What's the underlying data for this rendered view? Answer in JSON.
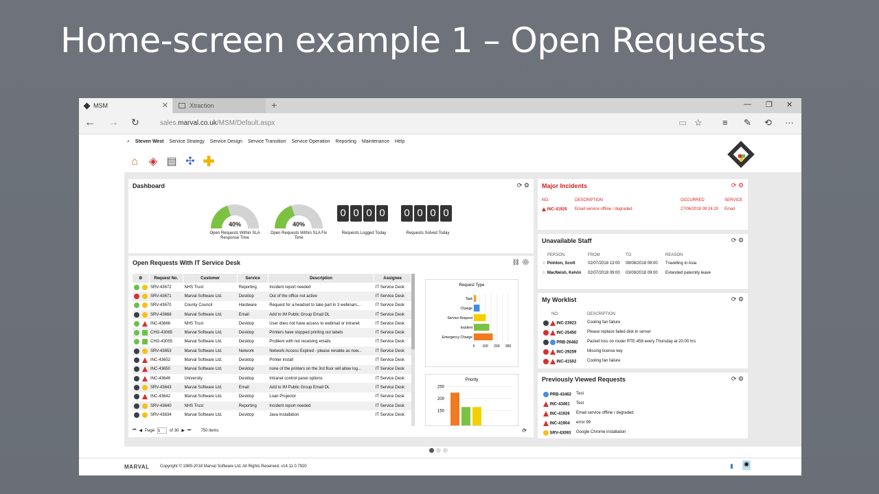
{
  "slide": {
    "title": "Home-screen example 1 – Open Requests"
  },
  "browser": {
    "tabs": [
      {
        "label": "MSM"
      },
      {
        "label": "Xtraction"
      }
    ],
    "url_prefix": "sales.",
    "url_host": "marval.co.uk",
    "url_path": "/MSM/Default.aspx"
  },
  "app_nav": {
    "user": "Steven West",
    "items": [
      "Service Strategy",
      "Service Design",
      "Service Transition",
      "Service Operation",
      "Reporting",
      "Maintenance",
      "Help"
    ]
  },
  "dashboard": {
    "title": "Dashboard",
    "gauges": [
      {
        "value": "40%",
        "fraction": 0.4,
        "caption": "Open Requests Within SLA Response Time"
      },
      {
        "value": "40%",
        "fraction": 0.4,
        "caption": "Open Requests Within SLA Fix Time"
      }
    ],
    "counters": [
      {
        "digits": [
          "0",
          "0",
          "0",
          "0"
        ],
        "caption": "Requests Logged Today"
      },
      {
        "digits": [
          "0",
          "0",
          "0",
          "0"
        ],
        "caption": "Requests Solved Today"
      }
    ]
  },
  "open_requests": {
    "title": "Open Requests With IT Service Desk",
    "columns": [
      "Request No.",
      "Customer",
      "Service",
      "Description",
      "Assignee"
    ],
    "rows": [
      {
        "s": "green",
        "i": "circle-y",
        "no": "SRV-43672",
        "cust": "NHS Trust",
        "svc": "Reporting",
        "desc": "Incident report needed",
        "asg": "IT Service Desk"
      },
      {
        "s": "red",
        "i": "circle-y",
        "no": "SRV-43671",
        "cust": "Marval Software Ltd.",
        "svc": "Desktop",
        "desc": "Out of the office not active",
        "asg": "IT Service Desk"
      },
      {
        "s": "green",
        "i": "circle-y",
        "no": "SRV-43670",
        "cust": "County Council",
        "svc": "Hardware",
        "desc": "Request for a headset to take part in 3 webinars...",
        "asg": "IT Service Desk"
      },
      {
        "s": "dark",
        "i": "circle-y",
        "no": "SRV-43668",
        "cust": "Marval Software Ltd.",
        "svc": "Email",
        "desc": "Add to IM Public Group Email DL",
        "asg": "IT Service Desk"
      },
      {
        "s": "green",
        "i": "tri",
        "no": "INC-43666",
        "cust": "NHS Trust",
        "svc": "Desktop",
        "desc": "User does not have access to webmail or intranet",
        "asg": "IT Service Desk"
      },
      {
        "s": "green",
        "i": "sq",
        "no": "CHG-43065",
        "cust": "Marval Software Ltd.",
        "svc": "Desktop",
        "desc": "Printers have stopped printing out labels",
        "asg": "IT Service Desk"
      },
      {
        "s": "green",
        "i": "sq",
        "no": "CHG-43055",
        "cust": "Marval Software Ltd.",
        "svc": "Desktop",
        "desc": "Problem with not receiving emails",
        "asg": "IT Service Desk"
      },
      {
        "s": "dark",
        "i": "circle-y",
        "no": "SRV-43653",
        "cust": "Marval Software Ltd.",
        "svc": "Network",
        "desc": "Network Access Expired - please renable as now...",
        "asg": "IT Service Desk"
      },
      {
        "s": "dark",
        "i": "tri",
        "no": "INC-43652",
        "cust": "Marval Software Ltd.",
        "svc": "Desktop",
        "desc": "Printer install",
        "asg": "IT Service Desk"
      },
      {
        "s": "dark",
        "i": "tri",
        "no": "INC-43650",
        "cust": "Marval Software Ltd.",
        "svc": "Desktop",
        "desc": "none of the printers on the 3rd floor will allow log...",
        "asg": "IT Service Desk"
      },
      {
        "s": "dark",
        "i": "tri",
        "no": "INC-43646",
        "cust": "University",
        "svc": "Desktop",
        "desc": "Intranet control panel options",
        "asg": "IT Service Desk"
      },
      {
        "s": "dark",
        "i": "circle-y",
        "no": "SRV-43643",
        "cust": "Marval Software Ltd.",
        "svc": "Email",
        "desc": "Add to IM Public Group Email DL",
        "asg": "IT Service Desk"
      },
      {
        "s": "dark",
        "i": "tri",
        "no": "INC-43642",
        "cust": "Marval Software Ltd.",
        "svc": "Desktop",
        "desc": "Loan Projector",
        "asg": "IT Service Desk"
      },
      {
        "s": "dark",
        "i": "circle-y",
        "no": "SRV-43640",
        "cust": "NHS Trust",
        "svc": "Reporting",
        "desc": "Incident report needed",
        "asg": "IT Service Desk"
      },
      {
        "s": "dark",
        "i": "circle-y",
        "no": "SRV-43634",
        "cust": "Marval Software Ltd.",
        "svc": "Desktop",
        "desc": "Java Installation",
        "asg": "IT Service Desk"
      }
    ],
    "pager": {
      "page_label": "Page",
      "page": "1",
      "of": "of 30",
      "items": "750 items"
    }
  },
  "chart_data": [
    {
      "type": "bar",
      "orientation": "horizontal",
      "title": "Request Type",
      "categories": [
        "Task",
        "Change",
        "Service Request",
        "Incident",
        "Emergency Change"
      ],
      "values": [
        20,
        50,
        105,
        135,
        165
      ],
      "colors": [
        "#f0a030",
        "#3d8ede",
        "#f5d000",
        "#7dc142",
        "#f07a20"
      ],
      "xlim": [
        0,
        300
      ],
      "xticks": [
        "0",
        "50",
        "100",
        "150",
        "200",
        "250",
        "300"
      ]
    },
    {
      "type": "bar",
      "title": "Priority",
      "values": [
        225,
        165,
        165
      ],
      "colors": [
        "#f07a20",
        "#7dc142",
        "#f5d000"
      ],
      "ylim": [
        100,
        260
      ],
      "yticks": [
        "150",
        "200",
        "250"
      ]
    }
  ],
  "major_incidents": {
    "title": "Major Incidents",
    "headers": [
      "NO.",
      "DESCRIPTION",
      "OCCURRED",
      "SERVICE"
    ],
    "rows": [
      {
        "no": "INC-41926",
        "desc": "Email service offline / degraded",
        "occ": "27/06/2018 09:24:20",
        "svc": "Email"
      }
    ]
  },
  "unavailable_staff": {
    "title": "Unavailable Staff",
    "headers": [
      "PERSON",
      "FROM",
      "TO",
      "REASON"
    ],
    "rows": [
      {
        "person": "Pointon, Scott",
        "from": "02/07/2018 13:00",
        "to": "08/08/2018 09:00",
        "reason": "Travelling in Asia"
      },
      {
        "person": "MacNeish, Kelvin",
        "from": "02/07/2018 09:00",
        "to": "03/09/2018 09:00",
        "reason": "Extended paternity leave"
      }
    ]
  },
  "worklist": {
    "title": "My Worklist",
    "headers": [
      "NO.",
      "DESCRIPTION"
    ],
    "rows": [
      {
        "s": "dark",
        "i": "tri",
        "no": "INC-23923",
        "desc": "Cooling fan failure"
      },
      {
        "s": "red",
        "i": "tri",
        "no": "INC-25450",
        "desc": "Please replace failed disk in server"
      },
      {
        "s": "dark",
        "i": "circle-b",
        "no": "PRB-26482",
        "desc": "Packet loss on router RTE-458 every Thursday at 20.00 hrs"
      },
      {
        "s": "red",
        "i": "tri",
        "no": "INC-29259",
        "desc": "Missing license key"
      },
      {
        "s": "red",
        "i": "tri",
        "no": "INC-41502",
        "desc": "Cooling fan failure"
      }
    ]
  },
  "previously_viewed": {
    "title": "Previously Viewed Requests",
    "rows": [
      {
        "i": "circle-b",
        "no": "PRB-43462",
        "desc": "Test"
      },
      {
        "i": "tri",
        "no": "INC-43461",
        "desc": "Test"
      },
      {
        "i": "tri",
        "no": "INC-41926",
        "desc": "Email service offline / degraded"
      },
      {
        "i": "tri",
        "no": "INC-41904",
        "desc": "error 99"
      },
      {
        "i": "circle-y",
        "no": "SRV-43093",
        "desc": "Google Chrome installation"
      }
    ]
  },
  "footer": {
    "brand": "MARVAL",
    "copyright": "Copyright © 1989-2018 Marval Software Ltd. All Rights Reserved. v14.11.0.7920"
  },
  "colors": {
    "green": "#6cc04a",
    "red": "#d63030",
    "dark": "#3a3f4a",
    "yellow": "#f2c21b",
    "blue": "#4a90d9"
  }
}
